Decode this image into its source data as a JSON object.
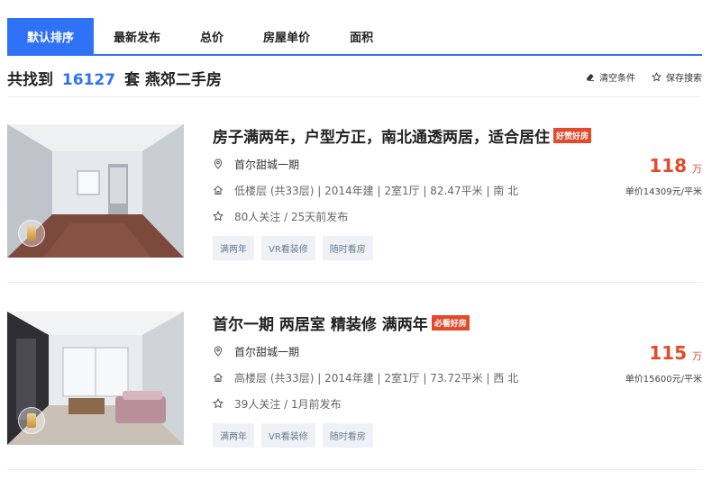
{
  "sort_tabs": [
    {
      "label": "默认排序",
      "active": true
    },
    {
      "label": "最新发布",
      "active": false
    },
    {
      "label": "总价",
      "active": false
    },
    {
      "label": "房屋单价",
      "active": false
    },
    {
      "label": "面积",
      "active": false
    }
  ],
  "result": {
    "prefix": "共找到",
    "count": "16127",
    "suffix": "套 燕郊二手房",
    "clear_label": "清空条件",
    "save_label": "保存搜索",
    "clear_icon": "eraser-icon",
    "save_icon": "star-outline-icon"
  },
  "listings": [
    {
      "title": "房子满两年，户型方正，南北通透两居，适合居住",
      "badge": "好赞好房",
      "community": "首尔甜城一期",
      "details": "低楼层 (共33层) | 2014年建 | 2室1厅 | 82.47平米 | 南 北",
      "follow": "80人关注 / 25天前发布",
      "tags": [
        "满两年",
        "VR看装修",
        "随时看房"
      ],
      "total_price": "118",
      "price_unit": "万",
      "unit_price": "单价14309元/平米"
    },
    {
      "title": "首尔一期 两居室 精装修 满两年",
      "badge": "必看好房",
      "community": "首尔甜城一期",
      "details": "高楼层 (共33层) | 2014年建 | 2室1厅 | 73.72平米 | 西 北",
      "follow": "39人关注 / 1月前发布",
      "tags": [
        "满两年",
        "VR看装修",
        "随时看房"
      ],
      "total_price": "115",
      "price_unit": "万",
      "unit_price": "单价15600元/平米"
    }
  ],
  "colors": {
    "accent": "#3072f6",
    "price": "#e14a2b",
    "badge": "#e14a2b",
    "tag_bg": "#eef2f6"
  }
}
